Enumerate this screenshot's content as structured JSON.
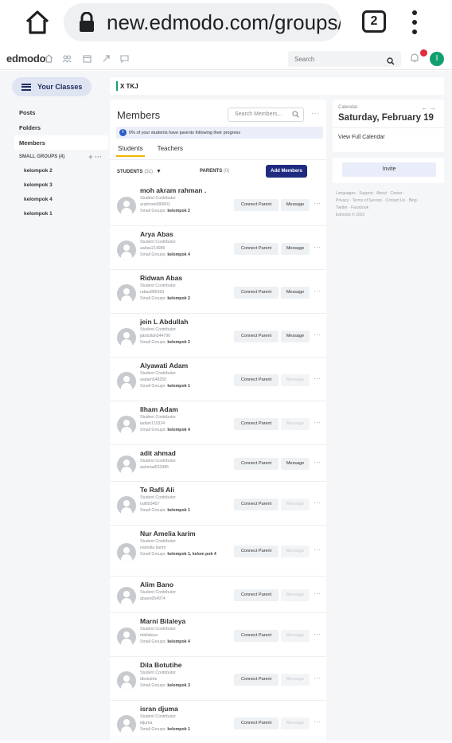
{
  "browser": {
    "url": "new.edmodo.com/groups/x-t",
    "tab_count": "2"
  },
  "header": {
    "logo": "edmodo",
    "search_placeholder": "Search",
    "avatar_initial": "I",
    "colors": {
      "notification": "#e02d3c",
      "avatar": "#12a06f"
    }
  },
  "sidebar": {
    "your_classes": "Your Classes",
    "items": [
      {
        "label": "Posts"
      },
      {
        "label": "Folders"
      },
      {
        "label": "Members",
        "active": true
      }
    ],
    "small_groups_label": "SMALL GROUPS (4)",
    "small_groups_actions": "+ ···",
    "groups": [
      "kelompok 2",
      "kelompok 3",
      "kelompok 4",
      "kelompok 1"
    ]
  },
  "class_bar": {
    "title": "X TKJ"
  },
  "members": {
    "title": "Members",
    "search_placeholder": "Search Members...",
    "more": "···",
    "info": "0% of your students have parents following their progress",
    "tabs": [
      "Students",
      "Teachers"
    ],
    "students_label": "STUDENTS",
    "students_count": "(31)",
    "parents_label": "PARENTS",
    "parents_count": "(0)",
    "add_members": "Add Members",
    "connect_label": "Connect Parent",
    "message_label": "Message",
    "rows": [
      {
        "name": "moh akram rahman .",
        "role": "Student Contributor",
        "username": "arahman589601",
        "groups_prefix": "Small Groups: ",
        "groups": "kelompok 2",
        "message_enabled": true
      },
      {
        "name": "Arya Abas",
        "role": "Student Contributor",
        "username": "aabas214986",
        "groups_prefix": "Small Groups: ",
        "groups": "kelompok 4",
        "message_enabled": true
      },
      {
        "name": "Ridwan Abas",
        "role": "Student Contributor",
        "username": "rabas885993",
        "groups_prefix": "Small Groups: ",
        "groups": "kelompok 2",
        "message_enabled": true
      },
      {
        "name": "jein L Abdullah",
        "role": "Student Contributor",
        "username": "jabdullah544790",
        "groups_prefix": "Small Groups: ",
        "groups": "kelompok 2",
        "message_enabled": true
      },
      {
        "name": "Alyawati Adam",
        "role": "Student Contributor",
        "username": "aadam548250",
        "groups_prefix": "Small Groups: ",
        "groups": "kelompok 1",
        "message_enabled": false
      },
      {
        "name": "Ilham Adam",
        "role": "Student Contributor",
        "username": "iadam115324",
        "groups_prefix": "Small Groups: ",
        "groups": "kelompok 4",
        "message_enabled": false
      },
      {
        "name": "adit ahmad",
        "role": "Student Contributor",
        "username": "aahmad633385",
        "groups_prefix": "",
        "groups": "",
        "message_enabled": true
      },
      {
        "name": "Te Rafli Ali",
        "role": "Student Contributor",
        "username": "rali693457",
        "groups_prefix": "Small Groups: ",
        "groups": "kelompok 1",
        "message_enabled": false
      },
      {
        "name": "Nur Amelia karim",
        "role": "Student Contributor",
        "username": "namelia karim",
        "groups_prefix": "Small Groups: ",
        "groups": "kelompok 1, kelom pok 4",
        "message_enabled": false
      },
      {
        "name": "Alim Bano",
        "role": "Student Contributor",
        "username": "abano654974",
        "groups_prefix": "",
        "groups": "",
        "message_enabled": false
      },
      {
        "name": "Marni Bilaleya",
        "role": "Student Contributor",
        "username": "mbilaleya",
        "groups_prefix": "Small Groups: ",
        "groups": "kelompok 4",
        "message_enabled": false
      },
      {
        "name": "Dila Botutihe",
        "role": "Student Contributor",
        "username": "dbotutihe",
        "groups_prefix": "Small Groups: ",
        "groups": "kelompok 3",
        "message_enabled": false
      },
      {
        "name": "isran djuma",
        "role": "Student Contributor",
        "username": "idjuma",
        "groups_prefix": "Small Groups: ",
        "groups": "kelompok 1",
        "message_enabled": false
      }
    ]
  },
  "calendar": {
    "label": "Calendar",
    "arrows": "← →",
    "date": "Saturday, February 19",
    "view_full": "View Full Calendar"
  },
  "invite": {
    "label": "Invite"
  },
  "footer": {
    "line1": "Languages · Support · About · Career ·",
    "line2": "Privacy · Terms of Service · Contact Us · Blog ·",
    "line3": "Twitter · Facebook",
    "line4": "Edmodo © 2022"
  }
}
